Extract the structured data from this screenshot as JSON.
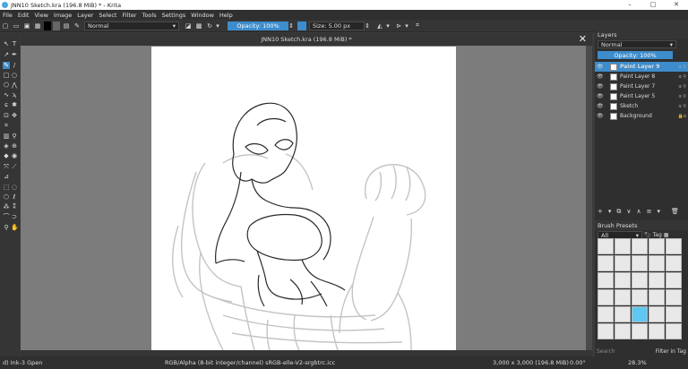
{
  "window": {
    "title": "JNN10 Sketch.kra (196.8 MiB) * - Krita",
    "minimize": "–",
    "maximize": "□",
    "close": "✕"
  },
  "menu": [
    "File",
    "Edit",
    "View",
    "Image",
    "Layer",
    "Select",
    "Filter",
    "Tools",
    "Settings",
    "Window",
    "Help"
  ],
  "toolbar": {
    "blend_mode": "Normal",
    "opacity_label": "Opacity: 100%",
    "size_label": "Size: 5.00 px"
  },
  "document": {
    "tab_title": "JNN10 Sketch.kra (196.8 MiB) *",
    "close": "✕"
  },
  "layers": {
    "header": "Layers",
    "blend_mode": "Normal",
    "opacity_label": "Opacity: 100%",
    "items": [
      {
        "name": "Paint Layer 9",
        "selected": true
      },
      {
        "name": "Paint Layer 8",
        "selected": false
      },
      {
        "name": "Paint Layer 7",
        "selected": false
      },
      {
        "name": "Paint Layer 5",
        "selected": false
      },
      {
        "name": "Sketch",
        "selected": false
      },
      {
        "name": "Background",
        "selected": false
      }
    ]
  },
  "brush_presets": {
    "header": "Brush Presets",
    "filter": "All",
    "tag": "Tag",
    "search_placeholder": "Search",
    "filter_in_tag": "Filter in Tag"
  },
  "status": {
    "brush": "d) Ink-3 Gpen",
    "colorspace": "RGB/Alpha (8-bit integer/channel)  sRGB-elle-V2-srgbtrc.icc",
    "dimensions": "3,000 x 3,000 (196.8 MiB)",
    "rotation": "0.00°",
    "zoom": "28.3%"
  },
  "colors": {
    "accent": "#3d8ccc",
    "foreground": "#000000",
    "background": "#ffffff"
  }
}
